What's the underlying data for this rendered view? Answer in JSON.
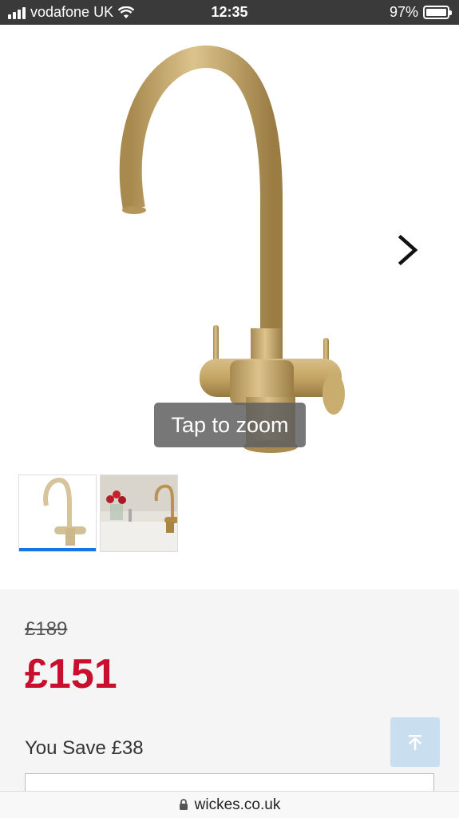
{
  "status_bar": {
    "carrier": "vodafone UK",
    "time": "12:35",
    "battery": "97%"
  },
  "gallery": {
    "zoom_hint": "Tap to zoom"
  },
  "pricing": {
    "was_price": "£189",
    "now_price": "£151",
    "you_save": "You Save £38"
  },
  "browser": {
    "url": "wickes.co.uk"
  },
  "colors": {
    "price_red": "#c8102e",
    "active_thumb": "#1a73e8",
    "faucet_gold": "#c9ad6f"
  }
}
